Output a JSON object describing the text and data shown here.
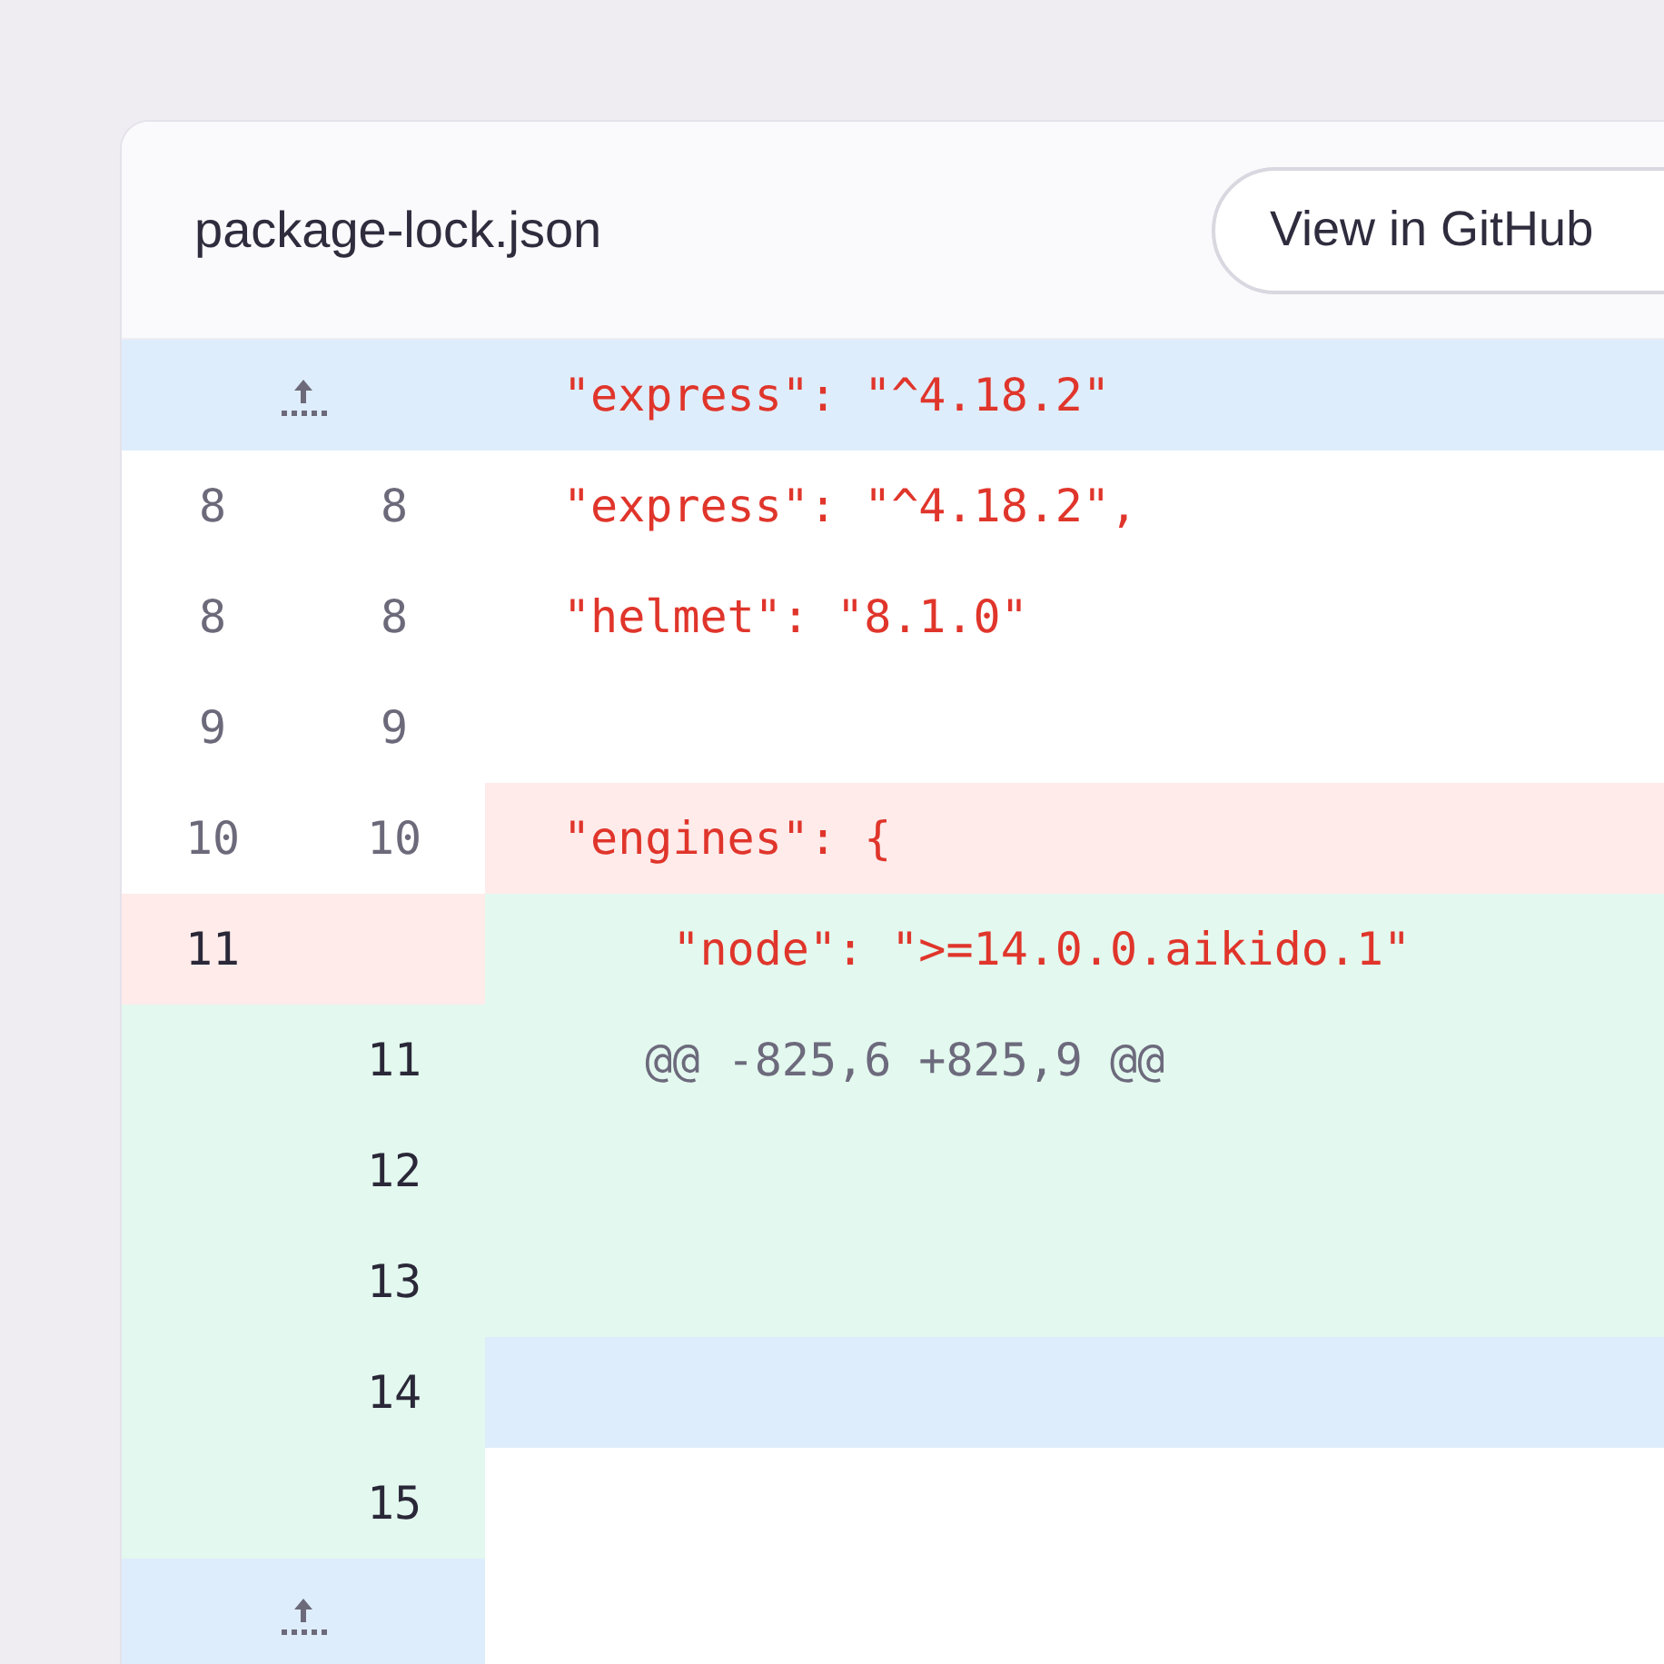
{
  "file": {
    "name": "package-lock.json",
    "button": "View in GitHub"
  },
  "rows": [
    {
      "gutter": {
        "kind": "expand"
      },
      "line": {
        "kind": "expand",
        "code": {
          "kind": "json",
          "text": "\"express\": \"^4.18.2\""
        }
      }
    },
    {
      "gutter": {
        "kind": "plain",
        "old": "8",
        "new": "8"
      },
      "line": {
        "kind": "plain",
        "code": {
          "kind": "json",
          "text": "\"express\": \"^4.18.2\","
        }
      }
    },
    {
      "gutter": {
        "kind": "plain",
        "old": "8",
        "new": "8"
      },
      "line": {
        "kind": "plain",
        "code": {
          "kind": "json",
          "text": "\"helmet\": \"8.1.0\""
        }
      }
    },
    {
      "gutter": {
        "kind": "plain",
        "old": "9",
        "new": "9"
      },
      "line": {
        "kind": "plain"
      }
    },
    {
      "gutter": {
        "kind": "plain",
        "old": "10",
        "new": "10"
      },
      "line": {
        "kind": "removed",
        "code": {
          "kind": "json",
          "text": "\"engines\": {"
        }
      }
    },
    {
      "gutter": {
        "kind": "removed",
        "old": "11"
      },
      "line": {
        "kind": "added",
        "code": {
          "kind": "json",
          "text": "    \"node\": \">=14.0.0.aikido.1\""
        }
      }
    },
    {
      "gutter": {
        "kind": "added",
        "new": "11"
      },
      "line": {
        "kind": "added",
        "code": {
          "kind": "hunk",
          "text": "   @@ -825,6 +825,9 @@"
        }
      }
    },
    {
      "gutter": {
        "kind": "added",
        "new": "12"
      },
      "line": {
        "kind": "added"
      }
    },
    {
      "gutter": {
        "kind": "added",
        "new": "13"
      },
      "line": {
        "kind": "added"
      }
    },
    {
      "gutter": {
        "kind": "added",
        "new": "14"
      },
      "line": {
        "kind": "expand"
      }
    },
    {
      "gutter": {
        "kind": "added",
        "new": "15"
      },
      "line": {
        "kind": "plain"
      }
    },
    {
      "gutter": {
        "kind": "expand"
      },
      "line": {
        "kind": "plain"
      }
    }
  ]
}
